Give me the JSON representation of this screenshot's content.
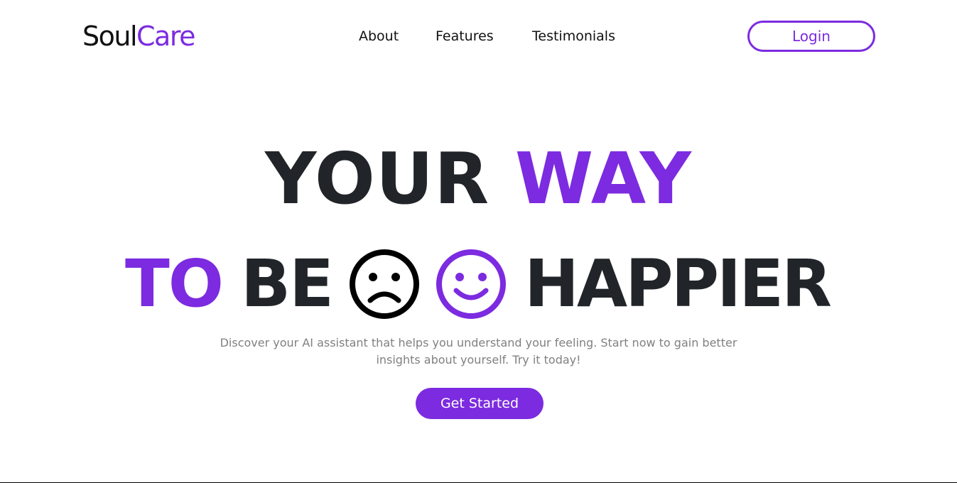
{
  "brand": {
    "part1": "Soul",
    "part2": "Care"
  },
  "nav": {
    "about": "About",
    "features": "Features",
    "testimonials": "Testimonials",
    "login": "Login"
  },
  "hero": {
    "line1_word1": "YOUR",
    "line1_word2": "WAY",
    "line2_word1": "TO",
    "line2_word2": "BE",
    "line2_word3": "HAPPIER",
    "sad_icon": "sad-face-icon",
    "happy_icon": "happy-face-icon",
    "subtitle": "Discover your AI assistant that helps you understand your feeling. Start now to gain better insights about yourself. Try it today!",
    "cta": "Get Started"
  },
  "colors": {
    "accent": "#7c2be0",
    "heading": "#212529",
    "muted": "#808080",
    "background": "#ffffff"
  }
}
